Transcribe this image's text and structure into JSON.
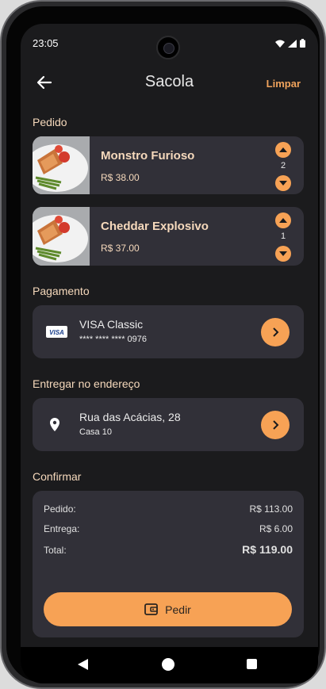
{
  "status": {
    "time": "23:05"
  },
  "header": {
    "title": "Sacola",
    "clear_label": "Limpar"
  },
  "order": {
    "section_label": "Pedido",
    "items": [
      {
        "name": "Monstro Furioso",
        "price": "R$ 38.00",
        "quantity": "2"
      },
      {
        "name": "Cheddar Explosivo",
        "price": "R$ 37.00",
        "quantity": "1"
      }
    ]
  },
  "payment": {
    "section_label": "Pagamento",
    "card_brand": "VISA",
    "card_name": "VISA Classic",
    "card_number": "**** **** **** 0976"
  },
  "delivery": {
    "section_label": "Entregar no endereço",
    "street": "Rua das Acácias, 28",
    "complement": "Casa 10"
  },
  "confirm": {
    "section_label": "Confirmar",
    "order_label": "Pedido:",
    "order_value": "R$ 113.00",
    "delivery_label": "Entrega:",
    "delivery_value": "R$ 6.00",
    "total_label": "Total:",
    "total_value": "R$ 119.00",
    "button_label": "Pedir"
  },
  "colors": {
    "accent": "#f7a255",
    "card": "#313038",
    "background": "#1b1b1d",
    "label": "#f6d9bc"
  }
}
